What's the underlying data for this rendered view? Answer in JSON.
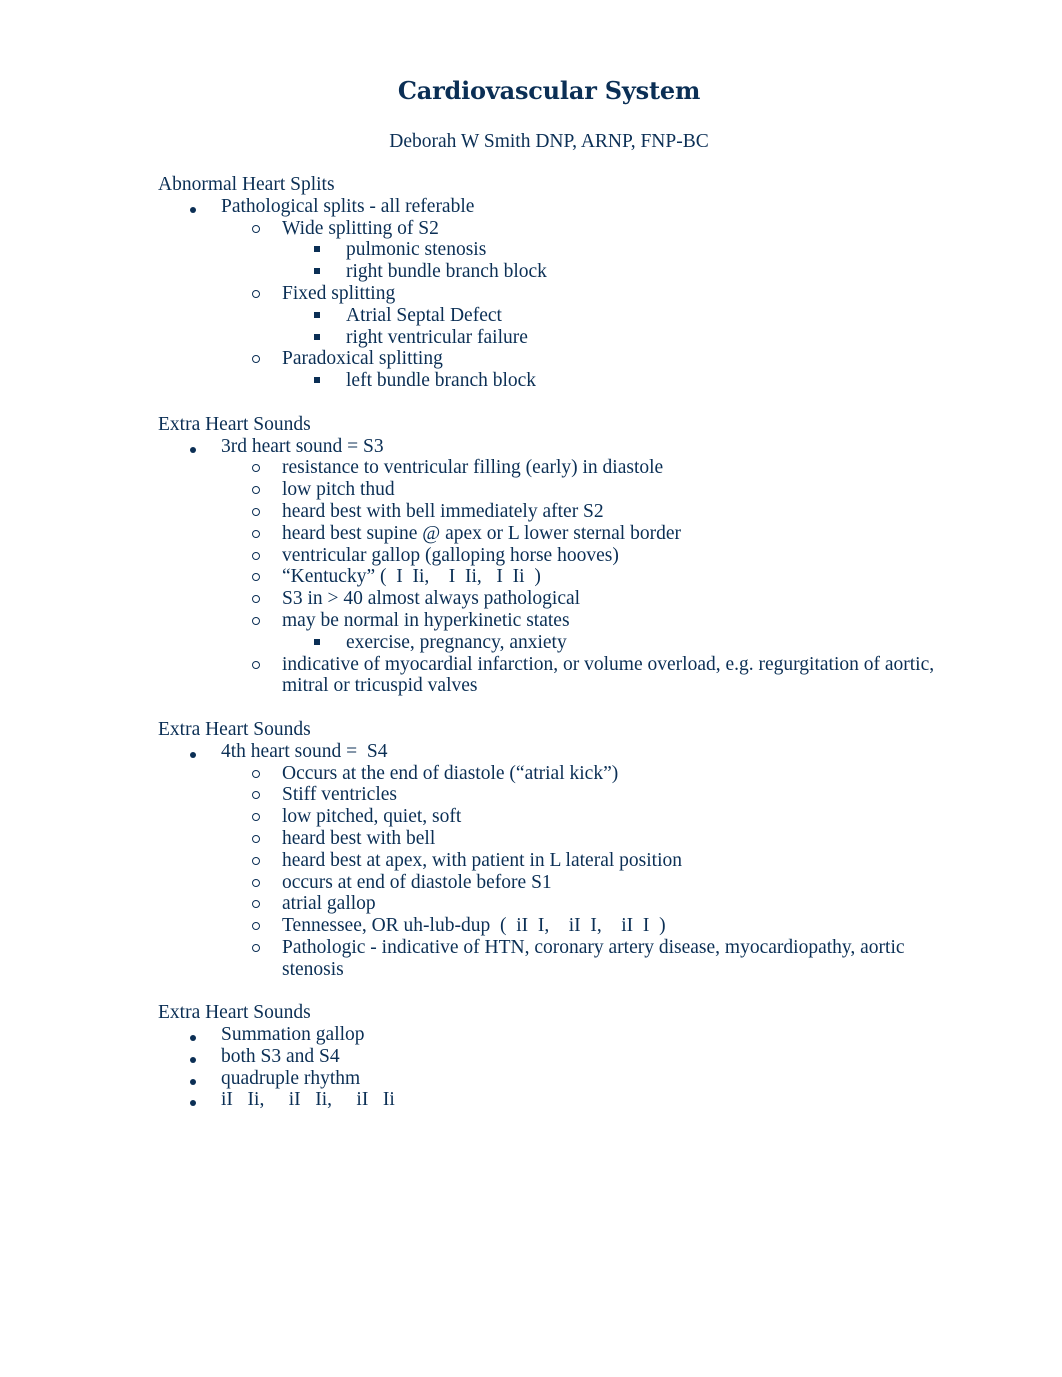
{
  "document": {
    "title": "Cardiovascular System",
    "author": "Deborah W Smith DNP, ARNP, FNP-BC",
    "text_color": "#0b2f55"
  },
  "sections": [
    {
      "heading": "Abnormal Heart Splits",
      "items": [
        {
          "level": 1,
          "bullet": "disc",
          "text": "Pathological splits - all referable"
        },
        {
          "level": 2,
          "bullet": "circle",
          "text": "Wide splitting of S2"
        },
        {
          "level": 3,
          "bullet": "square",
          "text": "pulmonic stenosis"
        },
        {
          "level": 3,
          "bullet": "square",
          "text": "right bundle branch block"
        },
        {
          "level": 2,
          "bullet": "circle",
          "text": "Fixed splitting"
        },
        {
          "level": 3,
          "bullet": "square",
          "text": "Atrial Septal Defect"
        },
        {
          "level": 3,
          "bullet": "square",
          "text": "right ventricular failure"
        },
        {
          "level": 2,
          "bullet": "circle",
          "text": "Paradoxical splitting"
        },
        {
          "level": 3,
          "bullet": "square",
          "text": "left bundle branch block"
        }
      ]
    },
    {
      "heading": "Extra Heart Sounds",
      "items": [
        {
          "level": 1,
          "bullet": "disc",
          "text": "3rd heart sound = S3"
        },
        {
          "level": 2,
          "bullet": "circle",
          "text": "resistance to ventricular filling (early) in diastole"
        },
        {
          "level": 2,
          "bullet": "circle",
          "text": "low pitch thud"
        },
        {
          "level": 2,
          "bullet": "circle",
          "text": "heard best with bell immediately after S2"
        },
        {
          "level": 2,
          "bullet": "circle",
          "text": "heard best supine @ apex or L lower sternal border"
        },
        {
          "level": 2,
          "bullet": "circle",
          "text": "ventricular gallop (galloping horse hooves)"
        },
        {
          "level": 2,
          "bullet": "circle",
          "text": "“Kentucky” (  I  Ii,    I  Ii,   I  Ii  )"
        },
        {
          "level": 2,
          "bullet": "circle",
          "text": "S3 in > 40 almost always pathological"
        },
        {
          "level": 2,
          "bullet": "circle",
          "text": "may be normal in hyperkinetic states"
        },
        {
          "level": 3,
          "bullet": "square",
          "text": "exercise, pregnancy, anxiety"
        },
        {
          "level": 2,
          "bullet": "circle",
          "text": "indicative of myocardial infarction, or volume overload, e.g. regurgitation of aortic, mitral or tricuspid valves"
        }
      ]
    },
    {
      "heading": "Extra Heart Sounds",
      "items": [
        {
          "level": 1,
          "bullet": "disc",
          "text": "4th heart sound =  S4"
        },
        {
          "level": 2,
          "bullet": "circle",
          "text": "Occurs at the end of diastole (“atrial kick”)"
        },
        {
          "level": 2,
          "bullet": "circle",
          "text": "Stiff ventricles"
        },
        {
          "level": 2,
          "bullet": "circle",
          "text": "low pitched, quiet, soft"
        },
        {
          "level": 2,
          "bullet": "circle",
          "text": "heard best with bell"
        },
        {
          "level": 2,
          "bullet": "circle",
          "text": "heard best at apex, with patient in L lateral position"
        },
        {
          "level": 2,
          "bullet": "circle",
          "text": "occurs at end of diastole before S1"
        },
        {
          "level": 2,
          "bullet": "circle",
          "text": "atrial gallop"
        },
        {
          "level": 2,
          "bullet": "circle",
          "text": "Tennessee, OR uh-lub-dup  (  iI  I,    iI  I,    iI  I  )"
        },
        {
          "level": 2,
          "bullet": "circle",
          "text": "Pathologic - indicative of HTN, coronary artery disease, myocardiopathy, aortic stenosis"
        }
      ]
    },
    {
      "heading": "Extra Heart Sounds",
      "items": [
        {
          "level": 1,
          "bullet": "disc",
          "text": "Summation gallop"
        },
        {
          "level": 1,
          "bullet": "disc",
          "text": "both S3 and S4"
        },
        {
          "level": 1,
          "bullet": "disc",
          "text": "quadruple rhythm"
        },
        {
          "level": 1,
          "bullet": "disc",
          "text": "iI   Ii,     iI   Ii,     iI   Ii"
        }
      ]
    }
  ]
}
